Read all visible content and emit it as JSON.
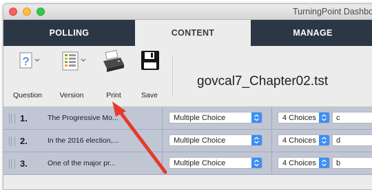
{
  "window": {
    "title": "TurningPoint Dashbo"
  },
  "tabs": [
    {
      "label": "POLLING"
    },
    {
      "label": "CONTENT"
    },
    {
      "label": "MANAGE"
    }
  ],
  "toolbar": {
    "question_label": "Question",
    "version_label": "Version",
    "print_label": "Print",
    "save_label": "Save",
    "question_icon_text": "?",
    "filename": "govcal7_Chapter02.tst"
  },
  "rows": [
    {
      "num": "1.",
      "text": "The Progressive Mo...",
      "type": "Multiple Choice",
      "choices": "4 Choices",
      "answer": "c"
    },
    {
      "num": "2.",
      "text": "In the 2016 election,...",
      "type": "Multiple Choice",
      "choices": "4 Choices",
      "answer": "d"
    },
    {
      "num": "3.",
      "text": "One of the major pr...",
      "type": "Multiple Choice",
      "choices": "4 Choices",
      "answer": "b"
    }
  ],
  "colors": {
    "tab_bar": "#2b3744",
    "row_bg": "#c1c6d5",
    "arrow": "#e53a2a",
    "select_accent": "#3c8ff5"
  }
}
